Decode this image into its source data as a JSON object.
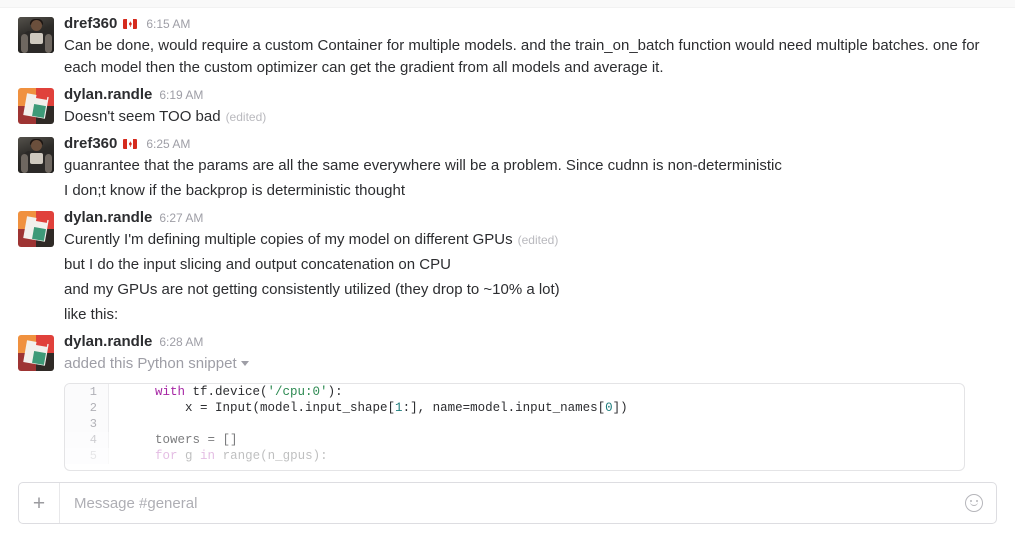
{
  "channel": "#general",
  "colors": {
    "text": "#2c2d30",
    "muted": "#9e9ea6",
    "keyword": "#a626a4",
    "string": "#2d8a52",
    "number": "#1c7c7c",
    "border": "#e4e4e6"
  },
  "messages": [
    {
      "author": "dref360",
      "flag": "canada-flag-emoji",
      "time": "6:15 AM",
      "avatar": "photo",
      "lines": [
        {
          "text": "Can be done, would require a custom Container for multiple models. and the train_on_batch function would need multiple batches. one for each model then the custom optimizer can get the gradient from all models and average it."
        }
      ]
    },
    {
      "author": "dylan.randle",
      "time": "6:19 AM",
      "avatar": "geometric",
      "lines": [
        {
          "text": "Doesn't seem TOO bad",
          "edited": "(edited)"
        }
      ]
    },
    {
      "author": "dref360",
      "flag": "canada-flag-emoji",
      "time": "6:25 AM",
      "avatar": "photo",
      "lines": [
        {
          "text": "guanrantee that the params are all the same everywhere will be a problem. Since cudnn is non-deterministic"
        },
        {
          "text": "I don;t know if the backprop is deterministic thought"
        }
      ]
    },
    {
      "author": "dylan.randle",
      "time": "6:27 AM",
      "avatar": "geometric",
      "lines": [
        {
          "text": "Curently I'm defining multiple copies of my model on different GPUs",
          "edited": "(edited)"
        },
        {
          "text": "but I do the input slicing and output concatenation on CPU"
        },
        {
          "text": "and my GPUs are not getting consistently utilized (they drop to ~10% a lot)"
        },
        {
          "text": "like this:"
        }
      ]
    }
  ],
  "snippet_message": {
    "author": "dylan.randle",
    "time": "6:28 AM",
    "avatar": "geometric",
    "meta_text": "added this Python snippet",
    "language": "Python"
  },
  "snippet": {
    "line_numbers": [
      "1",
      "2",
      "3",
      "4",
      "5"
    ],
    "lines": [
      {
        "number": "1",
        "fade": "none",
        "tokens": [
          {
            "t": "    ",
            "c": "plain"
          },
          {
            "t": "with",
            "c": "keyword"
          },
          {
            "t": " tf.device(",
            "c": "plain"
          },
          {
            "t": "'/cpu:0'",
            "c": "string"
          },
          {
            "t": "):",
            "c": "plain"
          }
        ]
      },
      {
        "number": "2",
        "fade": "none",
        "tokens": [
          {
            "t": "        x = Input(model.input_shape[",
            "c": "plain"
          },
          {
            "t": "1",
            "c": "number"
          },
          {
            "t": ":], name=model.input_names[",
            "c": "plain"
          },
          {
            "t": "0",
            "c": "number"
          },
          {
            "t": "])",
            "c": "plain"
          }
        ]
      },
      {
        "number": "3",
        "fade": "none",
        "tokens": [
          {
            "t": "",
            "c": "plain"
          }
        ]
      },
      {
        "number": "4",
        "fade": "light",
        "tokens": [
          {
            "t": "    towers = []",
            "c": "plain"
          }
        ]
      },
      {
        "number": "5",
        "fade": "heavy",
        "tokens": [
          {
            "t": "    ",
            "c": "plain"
          },
          {
            "t": "for",
            "c": "keyword"
          },
          {
            "t": " g ",
            "c": "plain"
          },
          {
            "t": "in",
            "c": "keyword"
          },
          {
            "t": " range(n_gpus):",
            "c": "plain"
          }
        ]
      }
    ]
  },
  "composer": {
    "placeholder": "Message #general",
    "value": "",
    "attach_label": "+",
    "emoji_label": "emoji"
  }
}
